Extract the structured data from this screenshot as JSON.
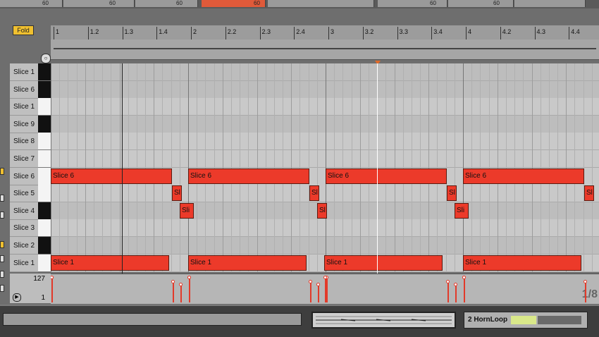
{
  "top_strip": {
    "values": [
      "60",
      "60",
      "60",
      "60",
      "60",
      "60"
    ]
  },
  "fold_button": {
    "label": "Fold"
  },
  "ruler": {
    "bars": [
      "1",
      "1.2",
      "1.3",
      "1.4",
      "2",
      "2.2",
      "2.3",
      "2.4",
      "3",
      "3.2",
      "3.3",
      "3.4",
      "4",
      "4.2",
      "4.3",
      "4.4"
    ]
  },
  "keys": [
    {
      "label": "Slice 1",
      "key": "black"
    },
    {
      "label": "Slice 6",
      "key": "black"
    },
    {
      "label": "Slice 1",
      "key": "white"
    },
    {
      "label": "Slice 9",
      "key": "black"
    },
    {
      "label": "Slice 8",
      "key": "white"
    },
    {
      "label": "Slice 7",
      "key": "white"
    },
    {
      "label": "Slice 6",
      "key": "white"
    },
    {
      "label": "Slice 5",
      "key": "white"
    },
    {
      "label": "Slice 4",
      "key": "black"
    },
    {
      "label": "Slice 3",
      "key": "white"
    },
    {
      "label": "Slice 2",
      "key": "black"
    },
    {
      "label": "Slice 1",
      "key": "white"
    }
  ],
  "notes": [
    {
      "label": "Slice 6",
      "lane": 6,
      "beat_start": 1.0,
      "beat_len": 0.88
    },
    {
      "label": "Slice 6",
      "lane": 6,
      "beat_start": 2.0,
      "beat_len": 0.88
    },
    {
      "label": "Slice 6",
      "lane": 6,
      "beat_start": 3.0,
      "beat_len": 0.88
    },
    {
      "label": "Slice 6",
      "lane": 6,
      "beat_start": 4.0,
      "beat_len": 0.88
    },
    {
      "label": "Sl",
      "lane": 7,
      "beat_start": 1.88,
      "beat_len": 0.07
    },
    {
      "label": "Sl",
      "lane": 7,
      "beat_start": 2.88,
      "beat_len": 0.07
    },
    {
      "label": "Sl",
      "lane": 7,
      "beat_start": 3.88,
      "beat_len": 0.07
    },
    {
      "label": "Sl",
      "lane": 7,
      "beat_start": 4.88,
      "beat_len": 0.07
    },
    {
      "label": "Sli",
      "lane": 8,
      "beat_start": 1.94,
      "beat_len": 0.1
    },
    {
      "label": "Sl",
      "lane": 8,
      "beat_start": 2.94,
      "beat_len": 0.07
    },
    {
      "label": "Sli",
      "lane": 8,
      "beat_start": 3.94,
      "beat_len": 0.1
    },
    {
      "label": "Slice 1",
      "lane": 11,
      "beat_start": 1.0,
      "beat_len": 0.86
    },
    {
      "label": "Slice 1",
      "lane": 11,
      "beat_start": 2.0,
      "beat_len": 0.86
    },
    {
      "label": "Slice 1",
      "lane": 11,
      "beat_start": 2.99,
      "beat_len": 0.86
    },
    {
      "label": "Slice 1",
      "lane": 11,
      "beat_start": 4.0,
      "beat_len": 0.86
    }
  ],
  "velocity": {
    "max_label": "127",
    "min_label": "1",
    "zoom_label": "1/8"
  },
  "clip": {
    "name": "2 HornLoop"
  },
  "colors": {
    "note": "#ec3a2a",
    "fold": "#f0c030",
    "playhead": "#ffffff",
    "marker": "#e06a2a"
  }
}
